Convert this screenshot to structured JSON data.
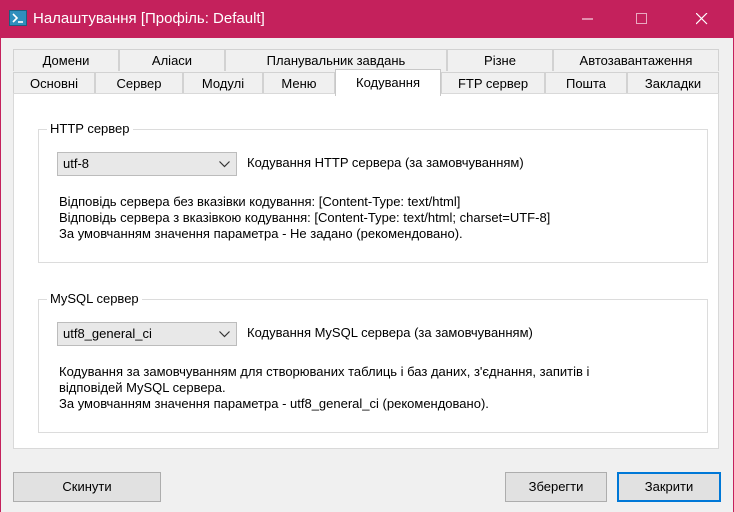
{
  "window": {
    "title": "Налаштування [Профіль: Default]"
  },
  "tabs_row1": [
    {
      "label": "Домени"
    },
    {
      "label": "Аліаси"
    },
    {
      "label": "Планувальник завдань"
    },
    {
      "label": "Різне"
    },
    {
      "label": "Автозавантаження"
    }
  ],
  "tabs_row2": [
    {
      "label": "Основні"
    },
    {
      "label": "Сервер"
    },
    {
      "label": "Модулі"
    },
    {
      "label": "Меню"
    },
    {
      "label": "Кодування",
      "active": true
    },
    {
      "label": "FTP сервер"
    },
    {
      "label": "Пошта"
    },
    {
      "label": "Закладки"
    }
  ],
  "http_group": {
    "title": "HTTP сервер",
    "combo_value": "utf-8",
    "combo_label": "Кодування HTTP сервера (за замовчуванням)",
    "desc_lines": [
      "Відповідь сервера без вказівки кодування: [Content-Type: text/html]",
      "Відповідь сервера з вказівкою кодування: [Content-Type: text/html; charset=UTF-8]",
      "За умовчанням значення параметра - Не задано (рекомендовано)."
    ]
  },
  "mysql_group": {
    "title": "MySQL сервер",
    "combo_value": "utf8_general_ci",
    "combo_label": "Кодування MySQL сервера (за замовчуванням)",
    "desc_lines": [
      "Кодування за замовчуванням для створюваних таблиць і баз даних, з'єднання, запитів і",
      "відповідей MySQL сервера.",
      "За умовчанням значення параметра - utf8_general_ci (рекомендовано)."
    ]
  },
  "buttons": {
    "reset": "Скинути",
    "save": "Зберегти",
    "close": "Закрити"
  },
  "colors": {
    "titlebar": "#c4215c",
    "focus_border": "#0078d7"
  }
}
